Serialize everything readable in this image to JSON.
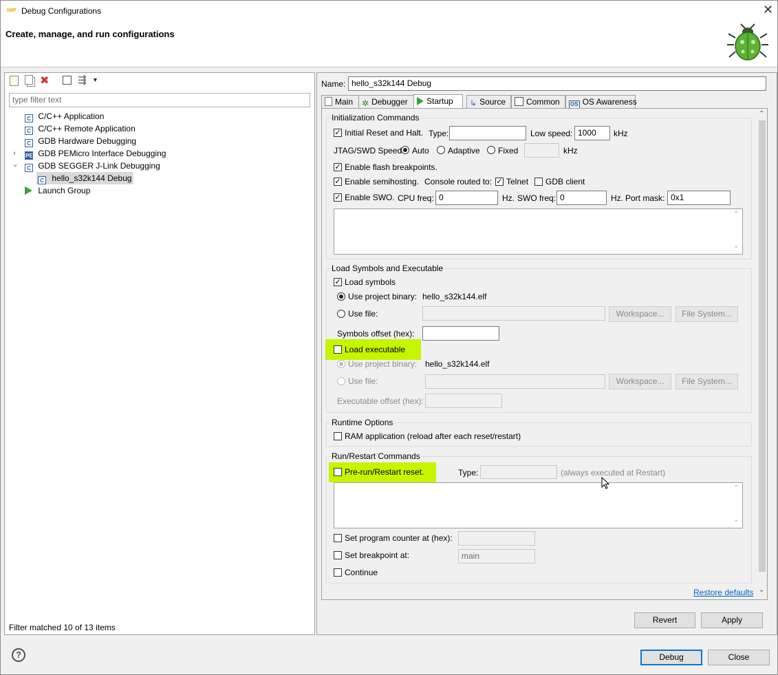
{
  "window": {
    "title": "Debug Configurations"
  },
  "header": {
    "title": "Create, manage, and run configurations"
  },
  "left": {
    "filter_placeholder": "type filter text",
    "tree": [
      {
        "label": "C/C++ Application"
      },
      {
        "label": "C/C++ Remote Application"
      },
      {
        "label": "GDB Hardware Debugging"
      },
      {
        "label": "GDB PEMicro Interface Debugging"
      },
      {
        "label": "GDB SEGGER J-Link Debugging"
      },
      {
        "label": "hello_s32k144 Debug"
      },
      {
        "label": "Launch Group"
      }
    ],
    "status": "Filter matched 10 of 13 items"
  },
  "right": {
    "name_label": "Name:",
    "name_value": "hello_s32k144 Debug",
    "tabs": [
      "Main",
      "Debugger",
      "Startup",
      "Source",
      "Common",
      "OS Awareness"
    ],
    "init": {
      "title": "Initialization Commands",
      "reset_label": "Initial Reset and Halt.",
      "type_label": "Type:",
      "type_value": "",
      "low_speed_label": "Low speed:",
      "low_speed_value": "1000",
      "khz": "kHz",
      "jtag_label": "JTAG/SWD Speed:",
      "auto": "Auto",
      "adaptive": "Adaptive",
      "fixed": "Fixed",
      "khz2": "kHz",
      "flash_bp": "Enable flash breakpoints.",
      "semihosting": "Enable semihosting.",
      "console_routed": "Console routed to:",
      "telnet": "Telnet",
      "gdb_client": "GDB client",
      "swo": "Enable SWO.",
      "cpu_freq_label": "CPU freq:",
      "cpu_freq_value": "0",
      "hz1": "Hz.",
      "swo_freq_label": "SWO freq:",
      "swo_freq_value": "0",
      "hz2": "Hz.",
      "port_mask_label": "Port mask:",
      "port_mask_value": "0x1"
    },
    "load": {
      "title": "Load Symbols and Executable",
      "load_symbols": "Load symbols",
      "use_project_binary": "Use project binary:",
      "binary_value": "hello_s32k144.elf",
      "use_file": "Use file:",
      "workspace": "Workspace...",
      "file_system": "File System...",
      "symbols_offset": "Symbols offset (hex):",
      "load_executable": "Load executable",
      "use_project_binary2": "Use project binary:",
      "binary_value2": "hello_s32k144.elf",
      "use_file2": "Use file:",
      "workspace2": "Workspace...",
      "file_system2": "File System...",
      "exec_offset": "Executable offset (hex):"
    },
    "runtime": {
      "title": "Runtime Options",
      "ram_app": "RAM application (reload after each reset/restart)"
    },
    "run": {
      "title": "Run/Restart Commands",
      "pre_run": "Pre-run/Restart reset.",
      "type_label": "Type:",
      "always": "(always executed at Restart)",
      "set_pc": "Set program counter at (hex):",
      "set_bp": "Set breakpoint at:",
      "bp_value": "main",
      "continue": "Continue"
    },
    "restore_defaults": "Restore defaults",
    "revert": "Revert",
    "apply": "Apply"
  },
  "footer": {
    "debug": "Debug",
    "close": "Close"
  },
  "colors": {
    "highlight": "#c6f500",
    "link": "#0066cc",
    "selection": "#cce8ff"
  }
}
